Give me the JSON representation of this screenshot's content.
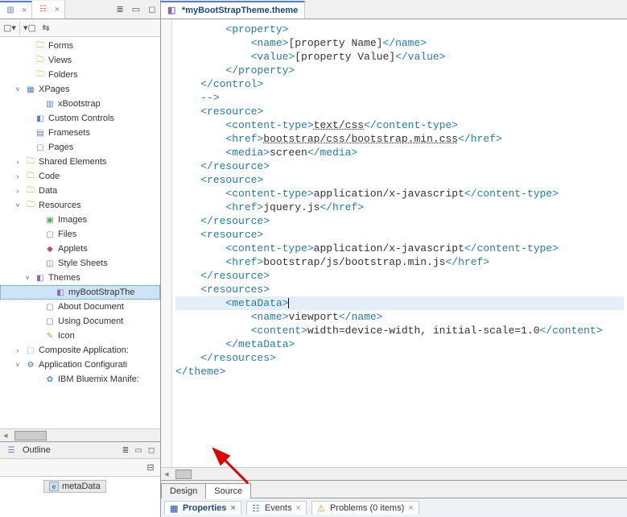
{
  "leftTabs": {
    "active_close": "×",
    "inactive_close": "×"
  },
  "tree": {
    "items": {
      "forms": "Forms",
      "views": "Views",
      "folders": "Folders",
      "xpages": "XPages",
      "xbootstrap": "xBootstrap",
      "custom_controls": "Custom Controls",
      "framesets": "Framesets",
      "pages": "Pages",
      "shared_elements": "Shared Elements",
      "code": "Code",
      "data": "Data",
      "resources": "Resources",
      "images": "Images",
      "files": "Files",
      "applets": "Applets",
      "style_sheets": "Style Sheets",
      "themes": "Themes",
      "mybootstraptheme": "myBootStrapThe",
      "about_document": "About Document",
      "using_document": "Using Document",
      "icon": "Icon",
      "composite_applications": "Composite Application:",
      "application_configuration": "Application Configurati",
      "ibm_bluemix": "IBM Bluemix Manife:"
    }
  },
  "outline": {
    "title": "Outline",
    "item_label": "metaData",
    "item_icon_text": "e"
  },
  "editor": {
    "tab_title": "*myBootStrapTheme.theme",
    "lines": [
      {
        "indent": 8,
        "pre": "<property>",
        "text": "",
        "post": ""
      },
      {
        "indent": 12,
        "pre": "<name>",
        "text": "[property Name]",
        "post": "</name>"
      },
      {
        "indent": 12,
        "pre": "<value>",
        "text": "[property Value]",
        "post": "</value>"
      },
      {
        "indent": 8,
        "pre": "</property>",
        "text": "",
        "post": ""
      },
      {
        "indent": 4,
        "pre": "</control>",
        "text": "",
        "post": ""
      },
      {
        "indent": 4,
        "pre": "-->",
        "text": "",
        "post": "",
        "comment": true
      },
      {
        "indent": 0,
        "pre": "",
        "text": "",
        "post": ""
      },
      {
        "indent": 4,
        "pre": "<resource>",
        "text": "",
        "post": ""
      },
      {
        "indent": 8,
        "pre": "<content-type>",
        "text": "text/css",
        "post": "</content-type>",
        "dotted": true
      },
      {
        "indent": 8,
        "pre": "<href>",
        "text": "bootstrap/css/bootstrap.min.css",
        "post": "</href>",
        "dotted": true
      },
      {
        "indent": 8,
        "pre": "<media>",
        "text": "screen",
        "post": "</media>"
      },
      {
        "indent": 4,
        "pre": "</resource>",
        "text": "",
        "post": ""
      },
      {
        "indent": 0,
        "pre": "",
        "text": "",
        "post": ""
      },
      {
        "indent": 4,
        "pre": "<resource>",
        "text": "",
        "post": ""
      },
      {
        "indent": 8,
        "pre": "<content-type>",
        "text": "application/x-javascript",
        "post": "</content-type>"
      },
      {
        "indent": 8,
        "pre": "<href>",
        "text": "jquery.js",
        "post": "</href>"
      },
      {
        "indent": 4,
        "pre": "</resource>",
        "text": "",
        "post": ""
      },
      {
        "indent": 0,
        "pre": "",
        "text": "",
        "post": ""
      },
      {
        "indent": 4,
        "pre": "<resource>",
        "text": "",
        "post": ""
      },
      {
        "indent": 8,
        "pre": "<content-type>",
        "text": "application/x-javascript",
        "post": "</content-type>"
      },
      {
        "indent": 8,
        "pre": "<href>",
        "text": "bootstrap/js/bootstrap.min.js",
        "post": "</href>"
      },
      {
        "indent": 4,
        "pre": "</resource>",
        "text": "",
        "post": ""
      },
      {
        "indent": 0,
        "pre": "",
        "text": "",
        "post": ""
      },
      {
        "indent": 4,
        "pre": "<resources>",
        "text": "",
        "post": ""
      },
      {
        "indent": 8,
        "pre": "<metaData>",
        "text": "",
        "post": "",
        "hl": true,
        "cursor": true
      },
      {
        "indent": 12,
        "pre": "<name>",
        "text": "viewport",
        "post": "</name>"
      },
      {
        "indent": 12,
        "pre": "<content>",
        "text": "width=device-width, initial-scale=1.0",
        "post": "</content>"
      },
      {
        "indent": 8,
        "pre": "</metaData>",
        "text": "",
        "post": ""
      },
      {
        "indent": 4,
        "pre": "</resources>",
        "text": "",
        "post": ""
      },
      {
        "indent": 0,
        "pre": "",
        "text": "",
        "post": ""
      },
      {
        "indent": 0,
        "pre": "</theme>",
        "text": "",
        "post": ""
      }
    ]
  },
  "bottomTabs": {
    "design": "Design",
    "source": "Source"
  },
  "views": {
    "properties": "Properties",
    "events": "Events",
    "problems": "Problems (0 items)",
    "close": "×"
  }
}
